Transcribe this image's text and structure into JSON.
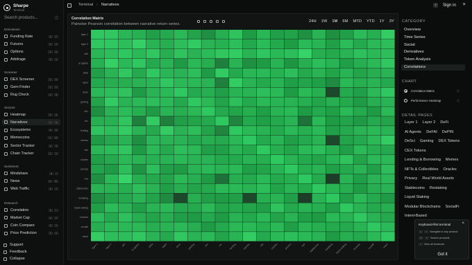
{
  "brand": {
    "name": "Sharpe",
    "subtitle": "Terminal"
  },
  "search": {
    "placeholder": "Search products...",
    "shortcut": "/"
  },
  "sidebar": {
    "sections": [
      {
        "label": "Derivatives",
        "items": [
          {
            "label": "Funding Rate",
            "keys": [
              "G",
              "F"
            ]
          },
          {
            "label": "Futures",
            "keys": [
              "G",
              "U"
            ]
          },
          {
            "label": "Options",
            "keys": [
              "G",
              "O"
            ]
          },
          {
            "label": "Arbitrage",
            "keys": [
              "G",
              "A"
            ]
          }
        ]
      },
      {
        "label": "Screener",
        "items": [
          {
            "label": "DEX Screener",
            "keys": [
              "G",
              "D"
            ]
          },
          {
            "label": "Gem Finder",
            "keys": [
              "G",
              "G"
            ]
          },
          {
            "label": "Rug Check",
            "keys": [
              "G",
              "R"
            ]
          }
        ]
      },
      {
        "label": "Sectors",
        "items": [
          {
            "label": "Heatmap",
            "keys": [
              "G",
              "H"
            ]
          },
          {
            "label": "Narratives",
            "keys": [
              "G",
              "N"
            ],
            "active": true
          },
          {
            "label": "Ecosystems",
            "keys": [
              "G",
              "E"
            ]
          },
          {
            "label": "Memecoins",
            "keys": [
              "G",
              "M"
            ]
          },
          {
            "label": "Sector Tracker",
            "keys": [
              "G",
              "S"
            ]
          },
          {
            "label": "Chain Tracker",
            "keys": [
              "G",
              "C"
            ]
          }
        ]
      },
      {
        "label": "Sentiment",
        "items": [
          {
            "label": "Mindshare",
            "keys": [
              "G",
              "I"
            ]
          },
          {
            "label": "News",
            "keys": [
              "G",
              "W"
            ]
          },
          {
            "label": "Web Traffic",
            "keys": [
              "G",
              "T"
            ]
          }
        ]
      },
      {
        "label": "Research",
        "items": [
          {
            "label": "Correlation",
            "keys": [
              "G",
              "L"
            ]
          },
          {
            "label": "Market Cap",
            "keys": [
              "G",
              "P"
            ]
          },
          {
            "label": "Coin Compare",
            "keys": [
              "G",
              "V"
            ]
          },
          {
            "label": "Price Prediction",
            "keys": [
              "G",
              "X"
            ]
          }
        ]
      }
    ],
    "footer": [
      "Support",
      "Feedback",
      "Collapse"
    ]
  },
  "topbar": {
    "breadcrumb": [
      "Terminal",
      "Narratives"
    ],
    "help": "?",
    "signin": "Sign in"
  },
  "card": {
    "title": "Correlation Matrix",
    "subtitle": "Pairwise Pearson correlation between narrative return series.",
    "ranges": [
      "24H",
      "1W",
      "1M",
      "6M",
      "MTD",
      "YTD",
      "1Y",
      "3Y"
    ],
    "selected_range": "1M"
  },
  "right_panel": {
    "category_header": "CATEGORY",
    "categories": [
      "Overview",
      "Time Series",
      "Social",
      "Derivatives",
      "Token Analysis",
      "Correlations"
    ],
    "active_category": "Correlations",
    "chart_header": "CHART",
    "chart_options": [
      "Correlation Matrix",
      "Performance Heatmap"
    ],
    "detail_header": "DETAIL PAGES",
    "detail_pages": [
      "Layer 1",
      "Layer 2",
      "DeFi",
      "AI Agents",
      "DeFAI",
      "DePIN",
      "DeSci",
      "Gaming",
      "DEX Tokens",
      "CEX Tokens",
      "Lending & Borrowing",
      "Memes",
      "NFTs & Collectibles",
      "Oracles",
      "Privacy",
      "Real World Assets",
      "Stablecoins",
      "Restaking",
      "Liquid Staking",
      "Modular Blockchains",
      "SocialFi",
      "Intent-Based"
    ]
  },
  "popup": {
    "title": "Keyboard-first terminal",
    "rows": [
      {
        "keys": [
          "G",
          "P"
        ],
        "text": "Navigate to any product"
      },
      {
        "keys": [
          "⌘",
          "K"
        ],
        "text": "Search products"
      },
      {
        "keys": [
          "?"
        ],
        "text": "View all shortcuts"
      }
    ],
    "button": "Got it"
  },
  "colors": {
    "cell_low": "#1d3325",
    "cell_mid": "#1f9a45",
    "cell_high": "#38d96b",
    "background": "#0b0d0c"
  },
  "chart_data": {
    "type": "heatmap",
    "title": "Correlation Matrix",
    "labels": [
      "layer 1",
      "layer 2",
      "defi",
      "ai agents",
      "defai",
      "depin",
      "desci",
      "gaming",
      "dex",
      "cex",
      "lending",
      "memes",
      "nfts",
      "oracles",
      "privacy",
      "rwa",
      "stablecoins",
      "restaking",
      "liquid staking",
      "modular",
      "socialfi",
      "intent"
    ],
    "matrix": [
      [
        1.0,
        0.78,
        0.71,
        0.69,
        0.62,
        0.66,
        0.72,
        0.64,
        0.58,
        0.68,
        0.76,
        0.6,
        0.71,
        0.62,
        0.63,
        0.58,
        0.7,
        0.58,
        0.62,
        0.73,
        0.68,
        0.8
      ],
      [
        0.78,
        1.0,
        0.74,
        0.81,
        0.7,
        0.68,
        0.74,
        0.79,
        0.7,
        0.69,
        0.74,
        0.65,
        0.73,
        0.66,
        0.6,
        0.72,
        0.7,
        0.62,
        0.73,
        0.66,
        0.72,
        0.74
      ],
      [
        0.71,
        0.74,
        1.0,
        0.72,
        0.78,
        0.68,
        0.76,
        0.7,
        0.73,
        0.77,
        0.8,
        0.7,
        0.77,
        0.72,
        0.74,
        0.83,
        0.68,
        0.66,
        0.7,
        0.75,
        0.72,
        0.74
      ],
      [
        0.69,
        0.81,
        0.72,
        1.0,
        0.66,
        0.7,
        0.6,
        0.72,
        0.68,
        0.55,
        0.7,
        0.58,
        0.6,
        0.7,
        0.59,
        0.68,
        0.74,
        0.7,
        0.62,
        0.68,
        0.72,
        0.78
      ],
      [
        0.62,
        0.7,
        0.78,
        0.66,
        1.0,
        0.71,
        0.7,
        0.74,
        0.6,
        0.79,
        0.66,
        0.71,
        0.72,
        0.69,
        0.74,
        0.66,
        0.7,
        0.64,
        0.7,
        0.64,
        0.68,
        0.7
      ],
      [
        0.66,
        0.68,
        0.68,
        0.7,
        0.71,
        1.0,
        0.72,
        0.72,
        0.7,
        0.55,
        0.8,
        0.7,
        0.66,
        0.7,
        0.62,
        0.64,
        0.62,
        0.57,
        0.72,
        0.68,
        0.7,
        0.66
      ],
      [
        0.72,
        0.74,
        0.76,
        0.6,
        0.7,
        0.72,
        1.0,
        0.66,
        0.68,
        0.62,
        0.7,
        0.7,
        0.74,
        0.72,
        0.6,
        0.72,
        0.68,
        0.44,
        0.66,
        0.62,
        0.72,
        0.78
      ],
      [
        0.64,
        0.79,
        0.7,
        0.72,
        0.74,
        0.72,
        0.66,
        1.0,
        0.72,
        0.64,
        0.74,
        0.66,
        0.72,
        0.7,
        0.7,
        0.68,
        0.64,
        0.68,
        0.66,
        0.6,
        0.68,
        0.7
      ],
      [
        0.58,
        0.7,
        0.73,
        0.68,
        0.6,
        0.7,
        0.68,
        0.72,
        1.0,
        0.66,
        0.64,
        0.68,
        0.62,
        0.7,
        0.72,
        0.6,
        0.66,
        0.62,
        0.72,
        0.66,
        0.6,
        0.72
      ],
      [
        0.68,
        0.69,
        0.77,
        0.55,
        0.79,
        0.55,
        0.62,
        0.64,
        0.66,
        1.0,
        0.56,
        0.66,
        0.62,
        0.66,
        0.7,
        0.52,
        0.72,
        0.6,
        0.64,
        0.6,
        0.66,
        0.64
      ],
      [
        0.76,
        0.74,
        0.8,
        0.7,
        0.66,
        0.8,
        0.7,
        0.74,
        0.64,
        0.56,
        1.0,
        0.72,
        0.7,
        0.66,
        0.72,
        0.68,
        0.72,
        0.62,
        0.66,
        0.7,
        0.72,
        0.7
      ],
      [
        0.6,
        0.65,
        0.7,
        0.58,
        0.71,
        0.7,
        0.7,
        0.66,
        0.68,
        0.66,
        0.72,
        1.0,
        0.66,
        0.7,
        0.62,
        0.66,
        0.7,
        0.44,
        0.64,
        0.66,
        0.72,
        0.8
      ],
      [
        0.71,
        0.73,
        0.77,
        0.6,
        0.72,
        0.66,
        0.74,
        0.72,
        0.62,
        0.62,
        0.7,
        0.66,
        1.0,
        0.68,
        0.64,
        0.72,
        0.74,
        0.68,
        0.62,
        0.72,
        0.68,
        0.66
      ],
      [
        0.62,
        0.66,
        0.72,
        0.7,
        0.69,
        0.7,
        0.72,
        0.7,
        0.7,
        0.66,
        0.66,
        0.7,
        0.68,
        1.0,
        0.7,
        0.66,
        0.64,
        0.7,
        0.76,
        0.64,
        0.72,
        0.72
      ],
      [
        0.63,
        0.6,
        0.74,
        0.59,
        0.74,
        0.62,
        0.6,
        0.7,
        0.72,
        0.7,
        0.72,
        0.62,
        0.64,
        0.7,
        1.0,
        0.68,
        0.7,
        0.62,
        0.66,
        0.7,
        0.62,
        0.74
      ],
      [
        0.58,
        0.72,
        0.83,
        0.68,
        0.66,
        0.64,
        0.72,
        0.68,
        0.6,
        0.52,
        0.68,
        0.66,
        0.72,
        0.66,
        0.68,
        1.0,
        0.66,
        0.42,
        0.7,
        0.62,
        0.7,
        0.72
      ],
      [
        0.7,
        0.7,
        0.68,
        0.74,
        0.7,
        0.62,
        0.68,
        0.64,
        0.66,
        0.72,
        0.72,
        0.7,
        0.74,
        0.64,
        0.7,
        0.66,
        1.0,
        0.7,
        0.68,
        0.6,
        0.68,
        0.7
      ],
      [
        0.58,
        0.62,
        0.66,
        0.7,
        0.64,
        0.57,
        0.44,
        0.68,
        0.62,
        0.6,
        0.62,
        0.44,
        0.68,
        0.7,
        0.62,
        0.42,
        0.7,
        1.0,
        0.62,
        0.72,
        0.66,
        0.6
      ],
      [
        0.62,
        0.73,
        0.7,
        0.62,
        0.7,
        0.72,
        0.66,
        0.66,
        0.72,
        0.64,
        0.66,
        0.64,
        0.62,
        0.76,
        0.66,
        0.7,
        0.68,
        0.62,
        1.0,
        0.7,
        0.66,
        0.68
      ],
      [
        0.73,
        0.66,
        0.75,
        0.68,
        0.64,
        0.68,
        0.62,
        0.6,
        0.66,
        0.6,
        0.7,
        0.66,
        0.72,
        0.64,
        0.7,
        0.62,
        0.6,
        0.72,
        0.7,
        1.0,
        0.7,
        0.66
      ],
      [
        0.68,
        0.72,
        0.72,
        0.72,
        0.68,
        0.7,
        0.72,
        0.68,
        0.6,
        0.66,
        0.72,
        0.72,
        0.68,
        0.72,
        0.62,
        0.7,
        0.68,
        0.66,
        0.66,
        0.7,
        1.0,
        0.72
      ],
      [
        0.8,
        0.74,
        0.74,
        0.78,
        0.7,
        0.66,
        0.78,
        0.7,
        0.72,
        0.64,
        0.7,
        0.8,
        0.66,
        0.72,
        0.74,
        0.72,
        0.7,
        0.6,
        0.68,
        0.66,
        0.72,
        1.0
      ]
    ]
  }
}
